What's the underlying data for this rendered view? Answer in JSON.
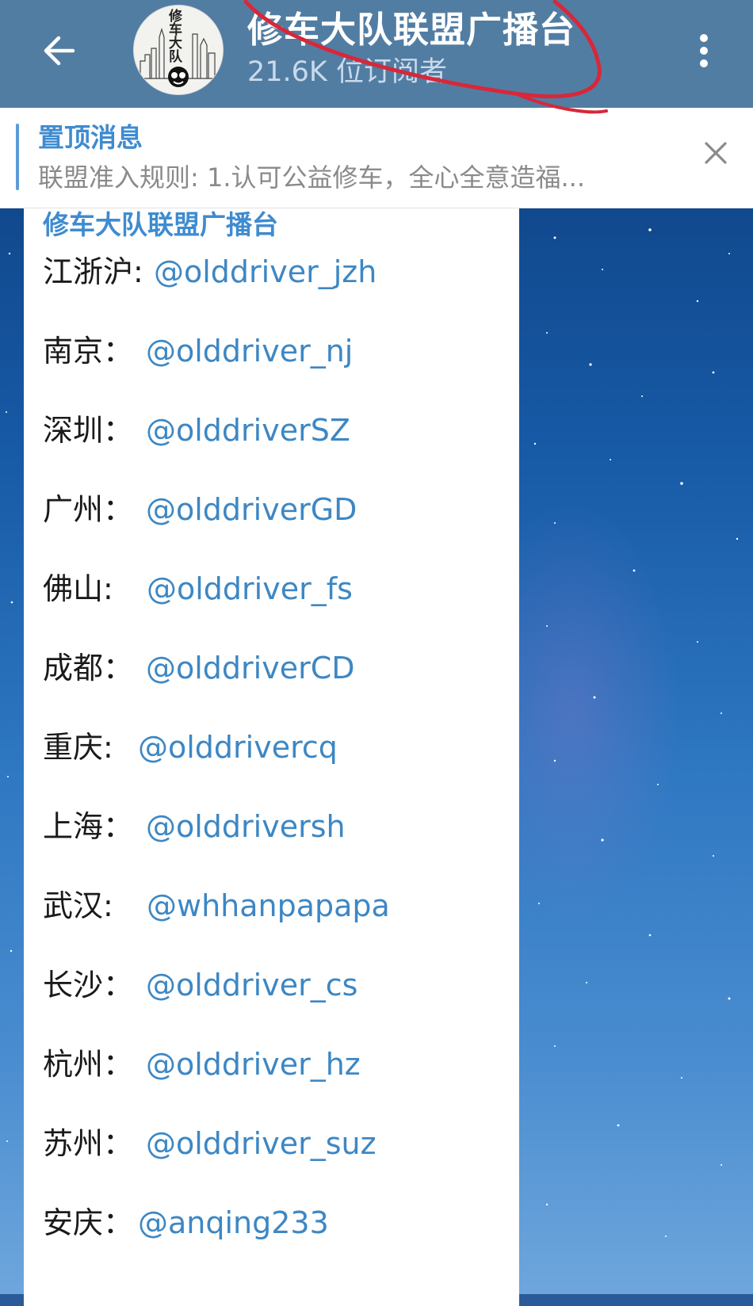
{
  "header": {
    "title": "修车大队联盟广播台",
    "subscribers": "21.6K 位订阅者",
    "avatar_text": "修车大队"
  },
  "pinned": {
    "label": "置顶消息",
    "text": "联盟准入规则: 1.认可公益修车，全心全意造福..."
  },
  "message": {
    "sender": "修车大队联盟广播台",
    "entries": [
      {
        "city": "江浙沪:",
        "handle": "@olddriver_jzh"
      },
      {
        "city": "南京：",
        "handle": "@olddriver_nj"
      },
      {
        "city": "深圳：",
        "handle": "@olddriverSZ"
      },
      {
        "city": "广州：",
        "handle": "@olddriverGD"
      },
      {
        "city": "佛山:",
        "handle": "@olddriver_fs"
      },
      {
        "city": "成都：",
        "handle": "@olddriverCD"
      },
      {
        "city": "重庆:",
        "handle": "@olddrivercq"
      },
      {
        "city": "上海：",
        "handle": "@olddriversh"
      },
      {
        "city": "武汉:",
        "handle": "@whhanpapapa"
      },
      {
        "city": "长沙：",
        "handle": "@olddriver_cs"
      },
      {
        "city": "杭州：",
        "handle": "@olddriver_hz"
      },
      {
        "city": "苏州：",
        "handle": "@olddriver_suz"
      },
      {
        "city": "安庆：",
        "handle": "@anqing233"
      }
    ]
  },
  "colors": {
    "header_bg": "#527da3",
    "link": "#3d87c4",
    "pinned_label": "#3f8bd0",
    "annotation": "#d6283a"
  },
  "icons": [
    "arrow-left-icon",
    "more-vertical-icon",
    "close-icon"
  ]
}
